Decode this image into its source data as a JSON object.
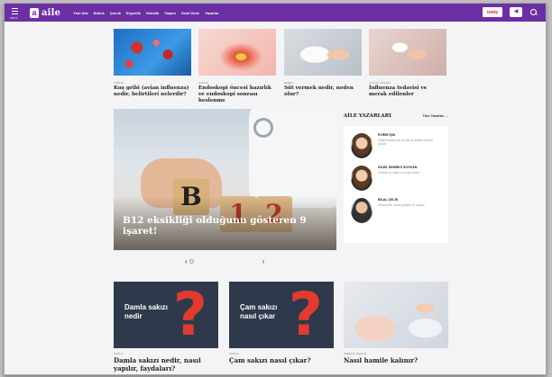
{
  "header": {
    "menu_label": "MENÜ",
    "logo_mark": "a",
    "site_name": "aile",
    "nav": [
      "Yeni Aile",
      "Bebek",
      "Çocuk",
      "Ergenlik",
      "Gebelik",
      "Yaşam",
      "Sesli Dinle",
      "Yazarlar"
    ],
    "login_label": "GİRİŞ",
    "play_glyph": "◀"
  },
  "top_articles": [
    {
      "category": "SAĞLIK",
      "title": "Kuş gribi (avian influenza) nedir, belirtileri nelerdir?"
    },
    {
      "category": "SAĞLIK",
      "title": "Endoskopi öncesi hazırlık ve endoskopi sonrası beslenme"
    },
    {
      "category": "BEBEK",
      "title": "Süt vermek nedir, neden olur?"
    },
    {
      "category": "ÇOCUK SAĞLIĞI",
      "title": "İnfluenza tedavisi ve merak edilenler"
    }
  ],
  "hero": {
    "title": "B12 eksikliği olduğunu gösteren 9 işaret!",
    "blocks": [
      "B",
      "1",
      "2"
    ]
  },
  "slider": {
    "prev": "‹",
    "next": "›"
  },
  "writers": {
    "title": "AİLE YAZARLARI",
    "all_link": "Tüm Yazarlar →",
    "items": [
      {
        "name": "EVRİM IŞIK",
        "text": "Sağlıklı beslenme ve aile içi iletişim üzerine yazılar"
      },
      {
        "name": "DİLEK DEMİRCİ SOYKAN",
        "text": "Gebelik ve doğum sonrası süreç"
      },
      {
        "name": "BİLAL ÇELİK",
        "text": "Ebeveynlik, çocuk gelişimi ve yaşam"
      }
    ]
  },
  "bottom_articles": [
    {
      "category": "SAĞLIK",
      "image_text": "Damla sakızı nedir",
      "title": "Damla sakızı nedir, nasıl yapılır, faydaları?"
    },
    {
      "category": "SAĞLIK",
      "image_text": "Çam sakızı nasıl çıkar",
      "title": "Çam sakızı nasıl çıkar?"
    },
    {
      "category": "GEBELİK ÖNCESİ",
      "image_text": "",
      "title": "Nasıl hamile kalınır?"
    }
  ],
  "colors": {
    "brand": "#6b2fa3",
    "login_text": "#d3143c",
    "question_mark": "#e23a2e"
  }
}
